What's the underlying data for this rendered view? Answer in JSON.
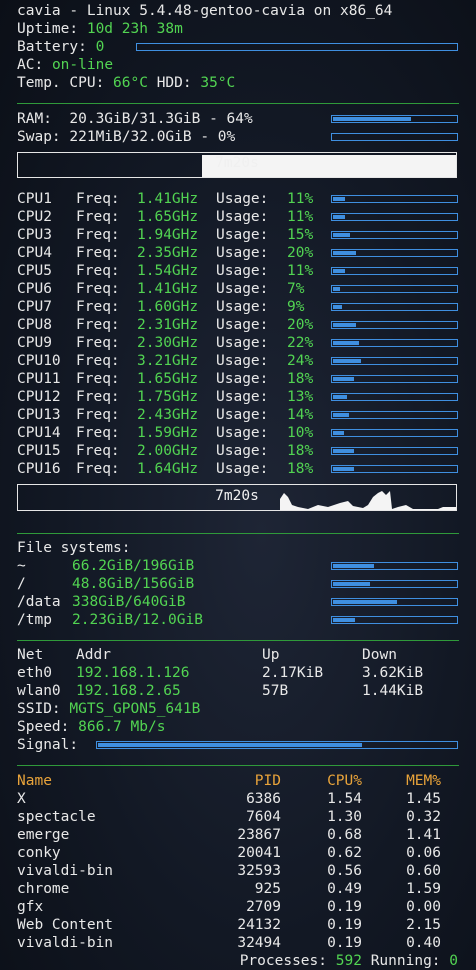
{
  "header": {
    "title": "cavia - Linux 5.4.48-gentoo-cavia on x86_64",
    "uptime_label": "Uptime:",
    "uptime_value": "10d 23h 38m",
    "battery_label": "Battery:",
    "battery_value": "0",
    "battery_level": 0,
    "ac_label": "AC:",
    "ac_value": "on-line",
    "temp_label": "Temp. CPU:",
    "temp_cpu": "66°C",
    "temp_hdd_label": "HDD:",
    "temp_hdd": "35°C"
  },
  "memory": {
    "ram_label": "RAM:",
    "ram_value": "20.3GiB/31.3GiB - 64%",
    "ram_level": 0.64,
    "swap_label": "Swap:",
    "swap_value": "221MiB/32.0GiB - 0%",
    "swap_level": 0.0,
    "graph_label": "7m20s"
  },
  "cpus": [
    {
      "name": "CPU1",
      "freq": "1.41GHz",
      "usage": "11%",
      "level": 0.11
    },
    {
      "name": "CPU2",
      "freq": "1.65GHz",
      "usage": "11%",
      "level": 0.11
    },
    {
      "name": "CPU3",
      "freq": "1.94GHz",
      "usage": "15%",
      "level": 0.15
    },
    {
      "name": "CPU4",
      "freq": "2.35GHz",
      "usage": "20%",
      "level": 0.2
    },
    {
      "name": "CPU5",
      "freq": "1.54GHz",
      "usage": "11%",
      "level": 0.11
    },
    {
      "name": "CPU6",
      "freq": "1.41GHz",
      "usage": "7%",
      "level": 0.07
    },
    {
      "name": "CPU7",
      "freq": "1.60GHz",
      "usage": "9%",
      "level": 0.09
    },
    {
      "name": "CPU8",
      "freq": "2.31GHz",
      "usage": "20%",
      "level": 0.2
    },
    {
      "name": "CPU9",
      "freq": "2.30GHz",
      "usage": "22%",
      "level": 0.22
    },
    {
      "name": "CPU10",
      "freq": "3.21GHz",
      "usage": "24%",
      "level": 0.24
    },
    {
      "name": "CPU11",
      "freq": "1.65GHz",
      "usage": "18%",
      "level": 0.18
    },
    {
      "name": "CPU12",
      "freq": "1.75GHz",
      "usage": "13%",
      "level": 0.13
    },
    {
      "name": "CPU13",
      "freq": "2.43GHz",
      "usage": "14%",
      "level": 0.14
    },
    {
      "name": "CPU14",
      "freq": "1.59GHz",
      "usage": "10%",
      "level": 0.1
    },
    {
      "name": "CPU15",
      "freq": "2.00GHz",
      "usage": "18%",
      "level": 0.18
    },
    {
      "name": "CPU16",
      "freq": "1.64GHz",
      "usage": "18%",
      "level": 0.18
    }
  ],
  "cpu_labels": {
    "freq": "Freq:",
    "usage": "Usage:"
  },
  "cpu_graph_label": "7m20s",
  "filesystems": {
    "title": "File systems:",
    "items": [
      {
        "mount": "~",
        "usage": "66.2GiB/196GiB",
        "level": 0.34
      },
      {
        "mount": "/",
        "usage": "48.8GiB/156GiB",
        "level": 0.31
      },
      {
        "mount": "/data",
        "usage": "338GiB/640GiB",
        "level": 0.53
      },
      {
        "mount": "/tmp",
        "usage": "2.23GiB/12.0GiB",
        "level": 0.19
      }
    ]
  },
  "network": {
    "headers": {
      "net": "Net",
      "addr": "Addr",
      "up": "Up",
      "down": "Down"
    },
    "interfaces": [
      {
        "name": "eth0",
        "addr": "192.168.1.126",
        "up": "2.17KiB",
        "down": "3.62KiB"
      },
      {
        "name": "wlan0",
        "addr": "192.168.2.65",
        "up": "57B",
        "down": "1.44KiB"
      }
    ],
    "ssid_label": "SSID:",
    "ssid": "MGTS_GPON5_641B",
    "speed_label": "Speed:",
    "speed": "866.7 Mb/s",
    "signal_label": "Signal:",
    "signal_level": 0.74
  },
  "processes": {
    "headers": {
      "name": "Name",
      "pid": "PID",
      "cpu": "CPU%",
      "mem": "MEM%"
    },
    "rows": [
      {
        "name": "X",
        "pid": "6386",
        "cpu": "1.54",
        "mem": "1.45"
      },
      {
        "name": "spectacle",
        "pid": "7604",
        "cpu": "1.30",
        "mem": "0.32"
      },
      {
        "name": "emerge",
        "pid": "23867",
        "cpu": "0.68",
        "mem": "1.41"
      },
      {
        "name": "conky",
        "pid": "20041",
        "cpu": "0.62",
        "mem": "0.06"
      },
      {
        "name": "vivaldi-bin",
        "pid": "32593",
        "cpu": "0.56",
        "mem": "0.60"
      },
      {
        "name": "chrome",
        "pid": "925",
        "cpu": "0.49",
        "mem": "1.59"
      },
      {
        "name": "gfx",
        "pid": "2709",
        "cpu": "0.19",
        "mem": "0.00"
      },
      {
        "name": "Web Content",
        "pid": "24132",
        "cpu": "0.19",
        "mem": "2.15"
      },
      {
        "name": "vivaldi-bin",
        "pid": "32494",
        "cpu": "0.19",
        "mem": "0.40"
      }
    ],
    "footer_processes_label": "Processes:",
    "footer_processes": "592",
    "footer_running_label": "Running:",
    "footer_running": "0"
  },
  "colors": {
    "text": "#e8e8e8",
    "value": "#52d452",
    "header": "#e8a33a",
    "bar": "#3f8fe0",
    "separator": "#2f9a3a"
  }
}
